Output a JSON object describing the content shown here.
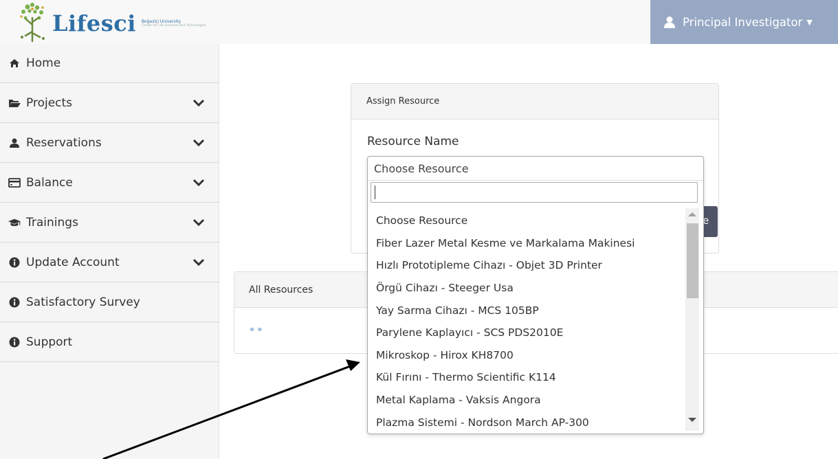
{
  "header": {
    "logo_text": "Lifesci",
    "logo_university": "Boğaziçi University",
    "logo_tagline": "Center for Life Sciences and Technologies",
    "user_label": "Principal Investigator",
    "user_icon": "user-icon",
    "accent_color": "#97a8c4"
  },
  "sidebar": {
    "items": [
      {
        "label": "Home",
        "icon": "home-icon",
        "expandable": false
      },
      {
        "label": "Projects",
        "icon": "folder-open-icon",
        "expandable": true
      },
      {
        "label": "Reservations",
        "icon": "user-icon",
        "expandable": true
      },
      {
        "label": "Balance",
        "icon": "credit-card-icon",
        "expandable": true
      },
      {
        "label": "Trainings",
        "icon": "graduation-cap-icon",
        "expandable": true
      },
      {
        "label": "Update Account",
        "icon": "info-circle-icon",
        "expandable": true
      },
      {
        "label": "Satisfactory Survey",
        "icon": "info-circle-icon",
        "expandable": false
      },
      {
        "label": "Support",
        "icon": "info-circle-icon",
        "expandable": false
      }
    ]
  },
  "assign_panel": {
    "title": "Assign Resource",
    "field_label": "Resource Name",
    "selected_value": "Choose Resource",
    "search_value": "",
    "options": [
      "Choose Resource",
      "Fiber Lazer Metal Kesme ve Markalama Makinesi",
      "Hızlı Prototipleme Cihazı - Objet 3D Printer",
      "Örgü Cihazı - Steeger Usa",
      "Yay Sarma Cihazı - MCS 105BP",
      "Parylene Kaplayıcı - SCS PDS2010E",
      "Mikroskop - Hirox KH8700",
      "Kül Fırını - Thermo Scientific K114",
      "Metal Kaplama - Vaksis Angora",
      "Plazma Sistemi - Nordson March AP-300"
    ]
  },
  "resources_panel": {
    "title": "All Resources",
    "pager": "« »"
  }
}
